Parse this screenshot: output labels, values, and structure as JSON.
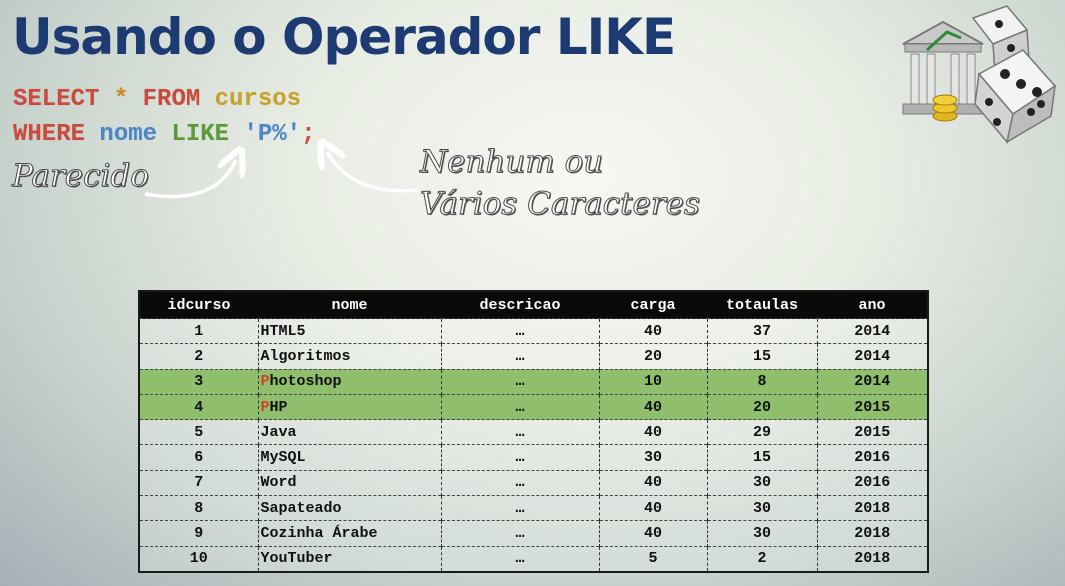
{
  "title": "Usando o Operador LIKE",
  "query": {
    "line1": {
      "select": "SELECT",
      "star": "*",
      "from": "FROM",
      "table": "cursos"
    },
    "line2": {
      "where": "WHERE",
      "column": "nome",
      "like": "LIKE",
      "pattern": "'P%'",
      "semicolon": ";"
    }
  },
  "annotations": {
    "left": "Parecido",
    "right_line1": "Nenhum ou",
    "right_line2": "Vários Caracteres"
  },
  "logo": {
    "icon": "bank-dice-icon"
  },
  "colors": {
    "title": "#1d3a72",
    "keyword": "#cc4a3c",
    "table": "#c9a227",
    "column": "#4a86c8",
    "like": "#5c9a3a",
    "highlight_row": "#8fbe6c",
    "matched_letter": "#d2401e"
  },
  "table": {
    "headers": [
      "idcurso",
      "nome",
      "descricao",
      "carga",
      "totaulas",
      "ano"
    ],
    "rows": [
      {
        "idcurso": "1",
        "nome_first": "H",
        "nome_rest": "TML5",
        "descricao": "…",
        "carga": "40",
        "totaulas": "37",
        "ano": "2014"
      },
      {
        "idcurso": "2",
        "nome_first": "A",
        "nome_rest": "lgoritmos",
        "descricao": "…",
        "carga": "20",
        "totaulas": "15",
        "ano": "2014"
      },
      {
        "idcurso": "3",
        "nome_first": "P",
        "nome_rest": "hotoshop",
        "descricao": "…",
        "carga": "10",
        "totaulas": "8",
        "ano": "2014"
      },
      {
        "idcurso": "4",
        "nome_first": "P",
        "nome_rest": "HP",
        "descricao": "…",
        "carga": "40",
        "totaulas": "20",
        "ano": "2015"
      },
      {
        "idcurso": "5",
        "nome_first": "J",
        "nome_rest": "ava",
        "descricao": "…",
        "carga": "40",
        "totaulas": "29",
        "ano": "2015"
      },
      {
        "idcurso": "6",
        "nome_first": "M",
        "nome_rest": "ySQL",
        "descricao": "…",
        "carga": "30",
        "totaulas": "15",
        "ano": "2016"
      },
      {
        "idcurso": "7",
        "nome_first": "W",
        "nome_rest": "ord",
        "descricao": "…",
        "carga": "40",
        "totaulas": "30",
        "ano": "2016"
      },
      {
        "idcurso": "8",
        "nome_first": "S",
        "nome_rest": "apateado",
        "descricao": "…",
        "carga": "40",
        "totaulas": "30",
        "ano": "2018"
      },
      {
        "idcurso": "9",
        "nome_first": "C",
        "nome_rest": "ozinha Árabe",
        "descricao": "…",
        "carga": "40",
        "totaulas": "30",
        "ano": "2018"
      },
      {
        "idcurso": "10",
        "nome_first": "Y",
        "nome_rest": "ouTuber",
        "descricao": "…",
        "carga": "5",
        "totaulas": "2",
        "ano": "2018"
      }
    ],
    "highlighted_rows": [
      3,
      4
    ]
  }
}
